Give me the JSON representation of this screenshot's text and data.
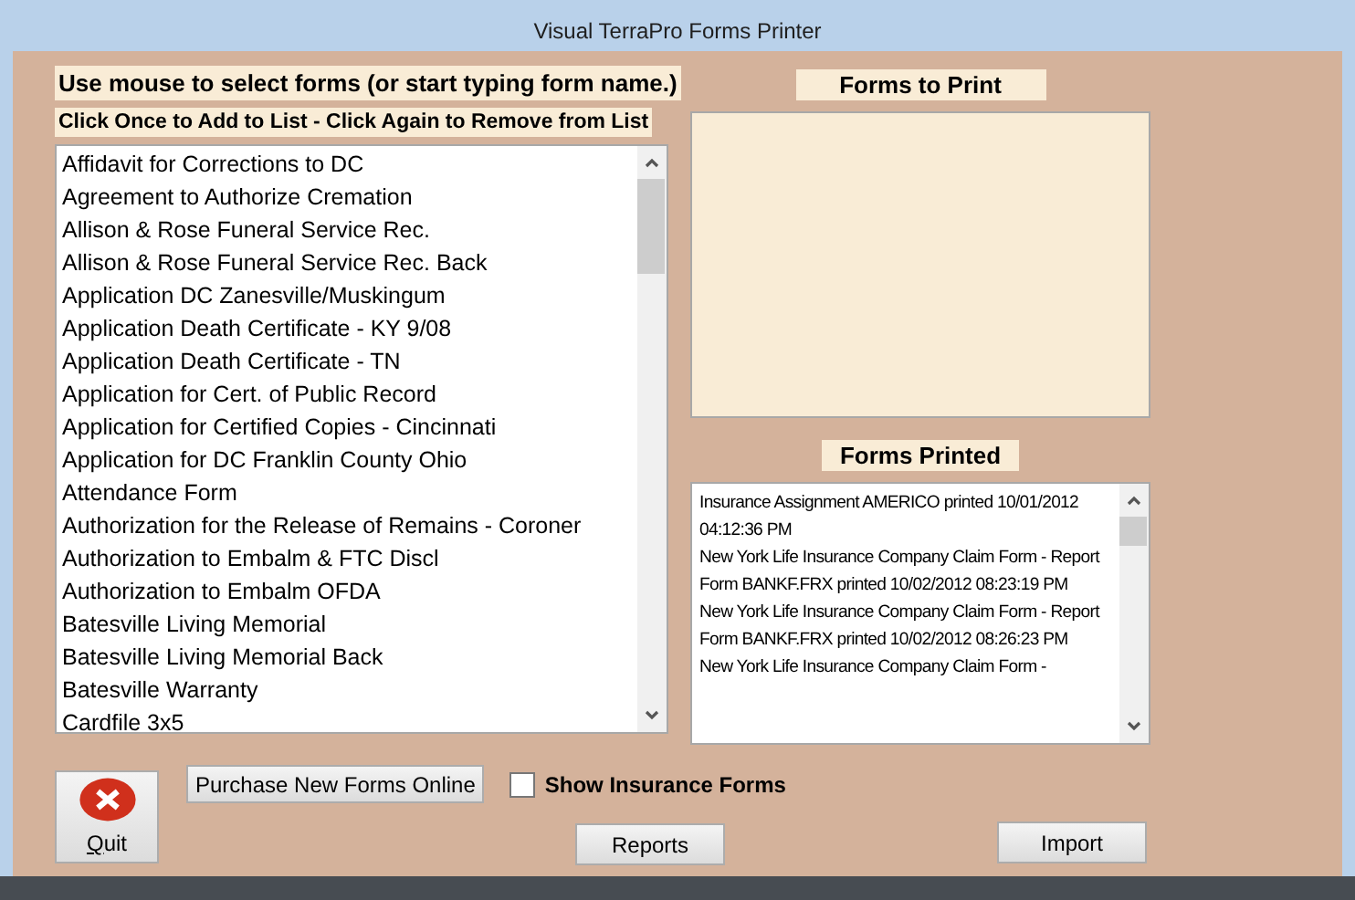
{
  "window": {
    "title": "Visual TerraPro Forms Printer"
  },
  "instructions": {
    "main": "Use mouse to select forms (or start typing form name.)",
    "hint": "Click Once to Add to List - Click Again to Remove from List"
  },
  "forms_list": [
    "Affidavit for Corrections to DC",
    "Agreement to Authorize Cremation",
    "Allison & Rose Funeral Service Rec.",
    "Allison & Rose Funeral Service Rec. Back",
    "Application DC Zanesville/Muskingum",
    "Application Death Certificate - KY 9/08",
    "Application Death Certificate - TN",
    "Application for Cert. of Public Record",
    "Application for Certified Copies - Cincinnati",
    "Application for DC Franklin County Ohio",
    "Attendance Form",
    "Authorization for the Release of Remains - Coroner",
    "Authorization to Embalm & FTC Discl",
    "Authorization to Embalm OFDA",
    "Batesville Living Memorial",
    "Batesville Living Memorial Back",
    "Batesville Warranty",
    "Cardfile 3x5"
  ],
  "forms_to_print": {
    "title": "Forms to Print"
  },
  "forms_printed": {
    "title": "Forms Printed",
    "entries": [
      "Insurance Assignment AMERICO printed 10/01/2012 04:12:36 PM",
      "New York Life Insurance Company Claim Form - Report Form BANKF.FRX printed 10/02/2012 08:23:19 PM",
      "New York Life Insurance Company Claim Form - Report Form BANKF.FRX printed 10/02/2012 08:26:23 PM",
      "New York Life Insurance Company Claim Form -"
    ]
  },
  "buttons": {
    "quit": "Quit",
    "purchase": "Purchase New Forms Online",
    "reports": "Reports",
    "import": "Import"
  },
  "show_insurance": {
    "label": "Show Insurance Forms",
    "checked": false
  }
}
